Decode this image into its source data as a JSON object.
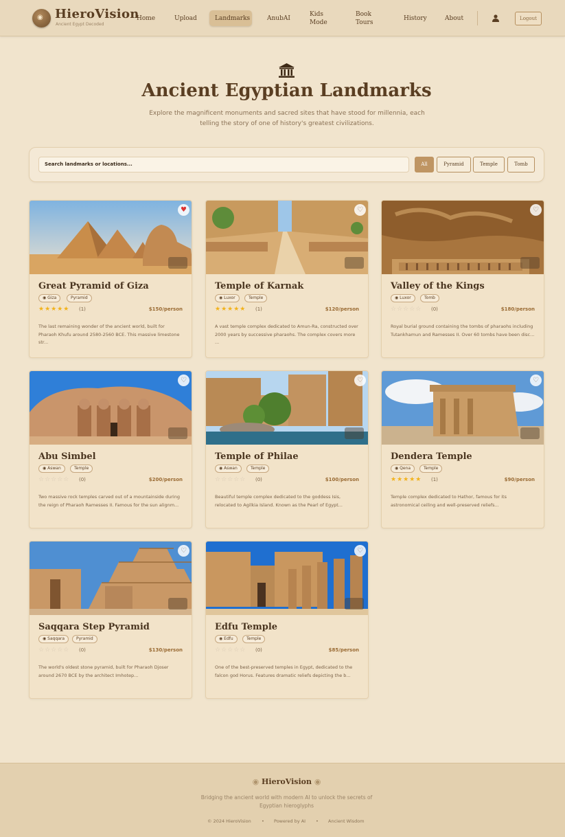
{
  "brand": {
    "name": "HieroVision",
    "tagline": "Ancient Egypt Decoded"
  },
  "nav": {
    "items": [
      "Home",
      "Upload",
      "Landmarks",
      "AnubAI",
      "Kids Mode",
      "Book Tours",
      "History",
      "About"
    ],
    "active": "Landmarks",
    "logout": "Logout"
  },
  "hero": {
    "title": "Ancient Egyptian Landmarks",
    "subtitle": "Explore the magnificent monuments and sacred sites that have stood for millennia, each telling the story of one of history's greatest civilizations."
  },
  "search": {
    "placeholder": "Search landmarks or locations..."
  },
  "filters": {
    "all": "All",
    "pyramid": "Pyramid",
    "temple": "Temple",
    "tomb": "Tomb"
  },
  "landmarks": [
    {
      "name": "Great Pyramid of Giza",
      "location": "Giza",
      "type": "Pyramid",
      "rating": 5,
      "reviews": "(1)",
      "price": "$150/person",
      "favorite": true,
      "description": "The last remaining wonder of the ancient world, built for Pharaoh Khufu around 2580-2560 BCE. This massive limestone str..."
    },
    {
      "name": "Temple of Karnak",
      "location": "Luxor",
      "type": "Temple",
      "rating": 5,
      "reviews": "(1)",
      "price": "$120/person",
      "favorite": false,
      "description": "A vast temple complex dedicated to Amun-Ra, constructed over 2000 years by successive pharaohs. The complex covers more ..."
    },
    {
      "name": "Valley of the Kings",
      "location": "Luxor",
      "type": "Tomb",
      "rating": 0,
      "reviews": "(0)",
      "price": "$180/person",
      "favorite": false,
      "description": "Royal burial ground containing the tombs of pharaohs including Tutankhamun and Ramesses II. Over 60 tombs have been disc..."
    },
    {
      "name": "Abu Simbel",
      "location": "Aswan",
      "type": "Temple",
      "rating": 0,
      "reviews": "(0)",
      "price": "$200/person",
      "favorite": false,
      "description": "Two massive rock temples carved out of a mountainside during the reign of Pharaoh Ramesses II. Famous for the sun alignm..."
    },
    {
      "name": "Temple of Philae",
      "location": "Aswan",
      "type": "Temple",
      "rating": 0,
      "reviews": "(0)",
      "price": "$100/person",
      "favorite": false,
      "description": "Beautiful temple complex dedicated to the goddess Isis, relocated to Agilkia Island. Known as the Pearl of Egypt..."
    },
    {
      "name": "Dendera Temple",
      "location": "Qena",
      "type": "Temple",
      "rating": 5,
      "reviews": "(1)",
      "price": "$90/person",
      "favorite": false,
      "description": "Temple complex dedicated to Hathor, famous for its astronomical ceiling and well-preserved reliefs..."
    },
    {
      "name": "Saqqara Step Pyramid",
      "location": "Saqqara",
      "type": "Pyramid",
      "rating": 0,
      "reviews": "(0)",
      "price": "$130/person",
      "favorite": false,
      "description": "The world's oldest stone pyramid, built for Pharaoh Djoser around 2670 BCE by the architect Imhotep..."
    },
    {
      "name": "Edfu Temple",
      "location": "Edfu",
      "type": "Temple",
      "rating": 0,
      "reviews": "(0)",
      "price": "$85/person",
      "favorite": false,
      "description": "One of the best-preserved temples in Egypt, dedicated to the falcon god Horus. Features dramatic reliefs depicting the b..."
    }
  ],
  "footer": {
    "brand": "HieroVision",
    "text": "Bridging the ancient world with modern AI to unlock the secrets of Egyptian hieroglyphs",
    "copyright": "© 2024 HieroVision",
    "powered": "Powered by AI",
    "wisdom": "Ancient Wisdom"
  },
  "colors": {
    "accent": "#bf9563",
    "brand_text": "#5a3e22",
    "star": "#f2b21b",
    "favorite": "#dd3333",
    "background": "#f1e4cd"
  },
  "icons": {
    "logo": "eye-of-horus-icon",
    "hero": "temple-icon",
    "user": "user-icon",
    "location": "location-pin-icon",
    "favorite": "heart-icon"
  }
}
